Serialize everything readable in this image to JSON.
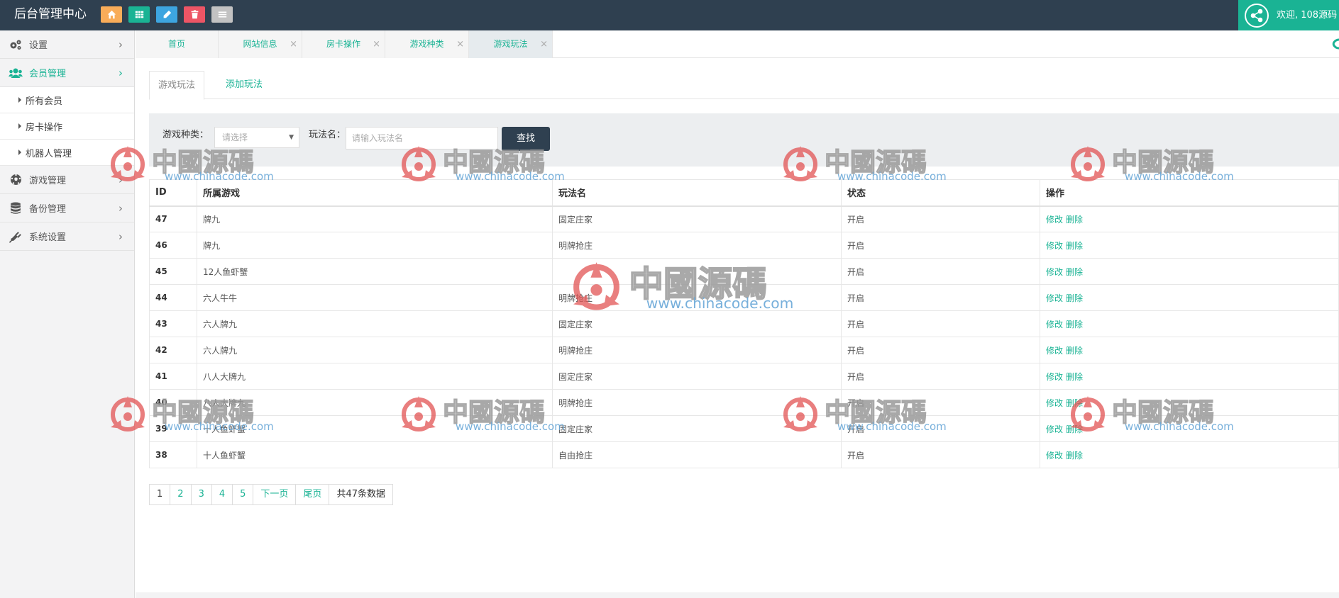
{
  "app": {
    "title": "后台管理中心",
    "welcome": "欢迎, 108源码",
    "quick_buttons": [
      {
        "icon": "home-icon",
        "color": "#f8ac59"
      },
      {
        "icon": "grid-icon",
        "color": "#1ab394"
      },
      {
        "icon": "pencil-icon",
        "color": "#3da5e0"
      },
      {
        "icon": "trash-icon",
        "color": "#ed5565"
      },
      {
        "icon": "list-icon",
        "color": "#c2c2c2"
      }
    ]
  },
  "sidebar": {
    "menus": [
      {
        "label": "设置",
        "icon": "gears-icon"
      },
      {
        "label": "会员管理",
        "icon": "users-icon"
      },
      {
        "label": "游戏管理",
        "icon": "soccer-ball-icon"
      },
      {
        "label": "备份管理",
        "icon": "database-icon"
      },
      {
        "label": "系统设置",
        "icon": "plug-icon"
      }
    ],
    "sub_items": [
      "所有会员",
      "房卡操作",
      "机器人管理"
    ]
  },
  "tabs": [
    "首页",
    "网站信息",
    "房卡操作",
    "游戏种类",
    "游戏玩法"
  ],
  "subtabs": {
    "active": "游戏玩法",
    "other": "添加玩法"
  },
  "filter": {
    "category_label": "游戏种类：",
    "category_placeholder": "请选择",
    "name_label": "玩法名：",
    "name_placeholder": "请输入玩法名",
    "search_button": "查找"
  },
  "table": {
    "headers": [
      "ID",
      "所属游戏",
      "玩法名",
      "状态",
      "操作"
    ],
    "edit_label": "修改",
    "delete_label": "删除",
    "rows": [
      {
        "id": "47",
        "game": "牌九",
        "play": "固定庄家",
        "status": "开启"
      },
      {
        "id": "46",
        "game": "牌九",
        "play": "明牌抢庄",
        "status": "开启"
      },
      {
        "id": "45",
        "game": "12人鱼虾蟹",
        "play": "",
        "status": "开启"
      },
      {
        "id": "44",
        "game": "六人牛牛",
        "play": "明牌抢庄",
        "status": "开启"
      },
      {
        "id": "43",
        "game": "六人牌九",
        "play": "固定庄家",
        "status": "开启"
      },
      {
        "id": "42",
        "game": "六人牌九",
        "play": "明牌抢庄",
        "status": "开启"
      },
      {
        "id": "41",
        "game": "八人大牌九",
        "play": "固定庄家",
        "status": "开启"
      },
      {
        "id": "40",
        "game": "八人大牌九",
        "play": "明牌抢庄",
        "status": "开启"
      },
      {
        "id": "39",
        "game": "十人鱼虾蟹",
        "play": "固定庄家",
        "status": "开启"
      },
      {
        "id": "38",
        "game": "十人鱼虾蟹",
        "play": "自由抢庄",
        "status": "开启"
      }
    ]
  },
  "pagination": {
    "pages": [
      "1",
      "2",
      "3",
      "4",
      "5"
    ],
    "next": "下一页",
    "last": "尾页",
    "total": "共47条数据"
  },
  "watermark": {
    "text": "中國源碼",
    "url": "www.chinacode.com"
  }
}
